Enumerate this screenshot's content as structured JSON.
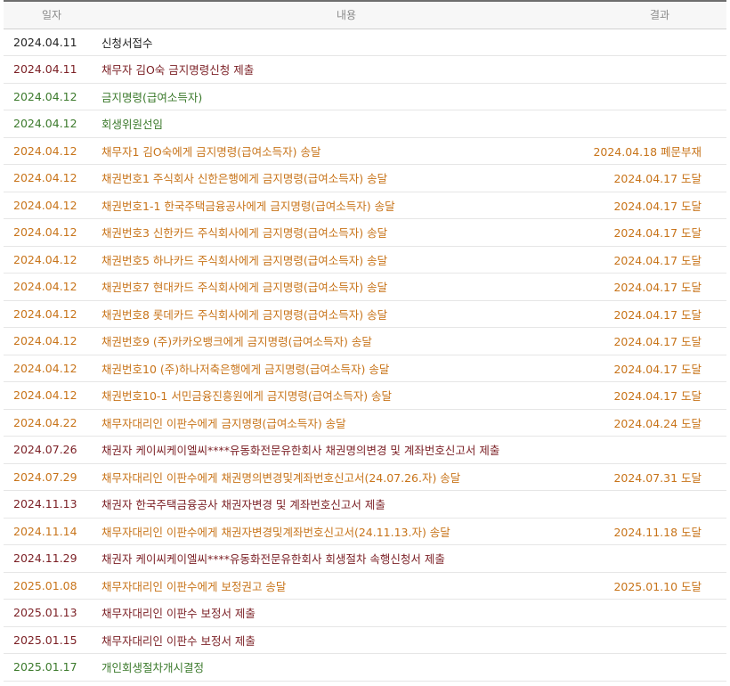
{
  "table": {
    "headers": {
      "date": "일자",
      "content": "내용",
      "result": "결과"
    },
    "colors": {
      "black": "#222222",
      "red": "#7b1f24",
      "green": "#3c7a2c",
      "orange": "#c8741a"
    },
    "rows": [
      {
        "date": "2024.04.11",
        "content": "신청서접수",
        "result": "",
        "style": "black"
      },
      {
        "date": "2024.04.11",
        "content": "채무자 김O숙 금지명령신청 제출",
        "result": "",
        "style": "red"
      },
      {
        "date": "2024.04.12",
        "content": "금지명령(급여소득자)",
        "result": "",
        "style": "green"
      },
      {
        "date": "2024.04.12",
        "content": "회생위원선임",
        "result": "",
        "style": "green"
      },
      {
        "date": "2024.04.12",
        "content": "채무자1 김O숙에게 금지명령(급여소득자) 송달",
        "result": "2024.04.18 폐문부재",
        "style": "orange"
      },
      {
        "date": "2024.04.12",
        "content": "채권번호1 주식회사 신한은행에게 금지명령(급여소득자) 송달",
        "result": "2024.04.17 도달",
        "style": "orange"
      },
      {
        "date": "2024.04.12",
        "content": "채권번호1-1 한국주택금융공사에게 금지명령(급여소득자) 송달",
        "result": "2024.04.17 도달",
        "style": "orange"
      },
      {
        "date": "2024.04.12",
        "content": "채권번호3 신한카드 주식회사에게 금지명령(급여소득자) 송달",
        "result": "2024.04.17 도달",
        "style": "orange"
      },
      {
        "date": "2024.04.12",
        "content": "채권번호5 하나카드 주식회사에게 금지명령(급여소득자) 송달",
        "result": "2024.04.17 도달",
        "style": "orange"
      },
      {
        "date": "2024.04.12",
        "content": "채권번호7 현대카드 주식회사에게 금지명령(급여소득자) 송달",
        "result": "2024.04.17 도달",
        "style": "orange"
      },
      {
        "date": "2024.04.12",
        "content": "채권번호8 롯데카드 주식회사에게 금지명령(급여소득자) 송달",
        "result": "2024.04.17 도달",
        "style": "orange"
      },
      {
        "date": "2024.04.12",
        "content": "채권번호9 (주)카카오뱅크에게 금지명령(급여소득자) 송달",
        "result": "2024.04.17 도달",
        "style": "orange"
      },
      {
        "date": "2024.04.12",
        "content": "채권번호10 (주)하나저축은행에게 금지명령(급여소득자) 송달",
        "result": "2024.04.17 도달",
        "style": "orange"
      },
      {
        "date": "2024.04.12",
        "content": "채권번호10-1 서민금융진흥원에게 금지명령(급여소득자) 송달",
        "result": "2024.04.17 도달",
        "style": "orange"
      },
      {
        "date": "2024.04.22",
        "content": "채무자대리인 이판수에게 금지명령(급여소득자) 송달",
        "result": "2024.04.24 도달",
        "style": "orange"
      },
      {
        "date": "2024.07.26",
        "content": "채권자 케이씨케이엘씨****유동화전문유한회사 채권명의변경 및 계좌번호신고서 제출",
        "result": "",
        "style": "red"
      },
      {
        "date": "2024.07.29",
        "content": "채무자대리인 이판수에게 채권명의변경및계좌번호신고서(24.07.26.자) 송달",
        "result": "2024.07.31 도달",
        "style": "orange"
      },
      {
        "date": "2024.11.13",
        "content": "채권자 한국주택금융공사 채권자변경 및 계좌번호신고서 제출",
        "result": "",
        "style": "red"
      },
      {
        "date": "2024.11.14",
        "content": "채무자대리인 이판수에게 채권자변경및계좌번호신고서(24.11.13.자) 송달",
        "result": "2024.11.18 도달",
        "style": "orange"
      },
      {
        "date": "2024.11.29",
        "content": "채권자 케이씨케이엘씨****유동화전문유한회사 회생절차 속행신청서 제출",
        "result": "",
        "style": "red"
      },
      {
        "date": "2025.01.08",
        "content": "채무자대리인 이판수에게 보정권고 송달",
        "result": "2025.01.10 도달",
        "style": "orange"
      },
      {
        "date": "2025.01.13",
        "content": "채무자대리인 이판수 보정서 제출",
        "result": "",
        "style": "red"
      },
      {
        "date": "2025.01.15",
        "content": "채무자대리인 이판수 보정서 제출",
        "result": "",
        "style": "red"
      },
      {
        "date": "2025.01.17",
        "content": "개인회생절차개시결정",
        "result": "",
        "style": "green"
      }
    ]
  }
}
